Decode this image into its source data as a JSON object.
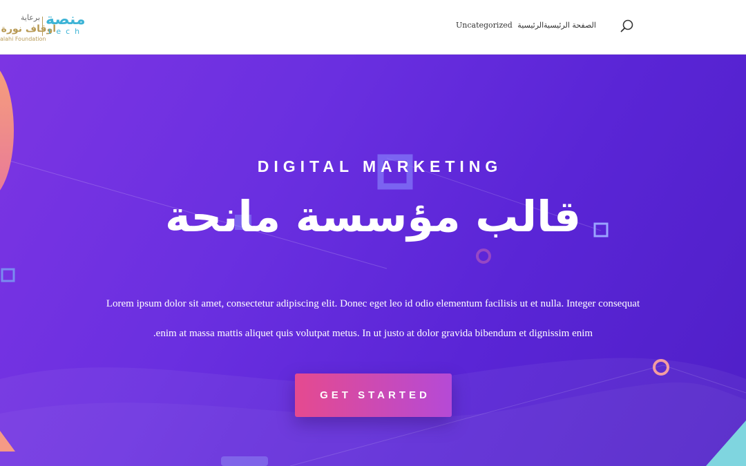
{
  "logo": {
    "brand_arabic": "منصة",
    "brand_sub": "tech",
    "sponsor_label": "برعاية",
    "sponsor_name": "أوقاف نورة ا",
    "sponsor_foundation": "alahi Foundation"
  },
  "nav": {
    "home": "الصفحة الرئيسية",
    "uncategorized": "Uncategorized",
    "uncategorized_ar": "الرئيسية",
    "search_icon": "search-icon"
  },
  "hero": {
    "eyebrow": "DIGITAL MARKETING",
    "title": "قالب مؤسسة مانحة",
    "paragraph_line1": "Lorem ipsum dolor sit amet, consectetur adipiscing elit. Donec eget leo id odio elementum facilisis ut et nulla. Integer consequat",
    "paragraph_line2": ".enim at massa mattis aliquet quis volutpat metus. In ut justo at dolor gravida bibendum et dignissim enim",
    "cta_label": "GET STARTED"
  },
  "colors": {
    "brand": "#3eb4d6",
    "sponsor_gold": "#b89a55",
    "hero_start": "#7c35e3",
    "hero_end": "#4f1fc7",
    "cta_start": "#e54a8f",
    "cta_end": "#b54ad6"
  }
}
